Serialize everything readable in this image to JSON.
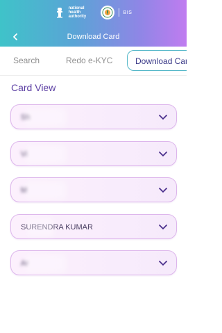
{
  "header": {
    "org_lines": [
      "national",
      "health",
      "authority"
    ],
    "bis_label": "BIS",
    "title": "Download Card",
    "gradient": [
      "#3fc3c9",
      "#8f86e6",
      "#c07cf0"
    ]
  },
  "tabs": [
    {
      "label": "Search",
      "active": false
    },
    {
      "label": "Redo e-KYC",
      "active": false
    },
    {
      "label": "Download Card",
      "active": true
    }
  ],
  "card_view": {
    "title": "Card View",
    "members": [
      {
        "name": "Sh"
      },
      {
        "name": "Vi"
      },
      {
        "name": "M"
      },
      {
        "name": "SURENDRA KUMAR"
      },
      {
        "name": "Ar"
      }
    ]
  },
  "colors": {
    "accent": "#5c3fa3",
    "tab_border": "#53b7c8",
    "card_border": "#ddb6ec",
    "card_bg": "#fcf0fd"
  }
}
